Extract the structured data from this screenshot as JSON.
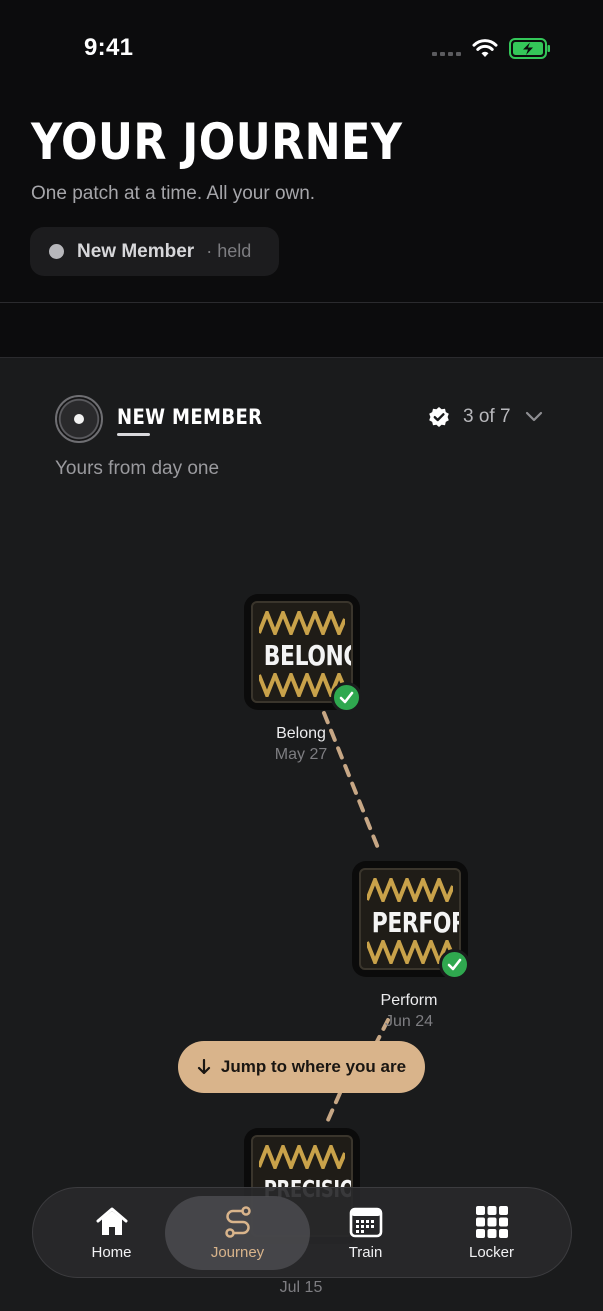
{
  "status_bar": {
    "time": "9:41"
  },
  "header": {
    "title": "YOUR JOURNEY",
    "subtitle": "One patch at a time. All your own.",
    "status_chip": {
      "label": "New Member",
      "suffix": "· held"
    }
  },
  "tier": {
    "name": "NEW MEMBER",
    "description": "Yours from day one",
    "progress": "3 of 7"
  },
  "patches": [
    {
      "word": "BELONG",
      "name": "Belong",
      "date": "May 27",
      "earned": true
    },
    {
      "word": "PERFORM",
      "name": "Perform",
      "date": "Jun 24",
      "earned": true
    },
    {
      "word": "PRECISION",
      "name": "",
      "date": "Jul 15",
      "earned": false
    }
  ],
  "jump_button": {
    "label": "Jump to where you are"
  },
  "tabs": [
    {
      "label": "Home",
      "icon": "home-icon",
      "active": false
    },
    {
      "label": "Journey",
      "icon": "journey-icon",
      "active": true
    },
    {
      "label": "Train",
      "icon": "calendar-icon",
      "active": false
    },
    {
      "label": "Locker",
      "icon": "grid-icon",
      "active": false
    }
  ],
  "colors": {
    "accent": "#d9b48b",
    "success": "#2fa84f",
    "background": "#1a1b1c",
    "patch_stripe": "#c9a24a"
  }
}
